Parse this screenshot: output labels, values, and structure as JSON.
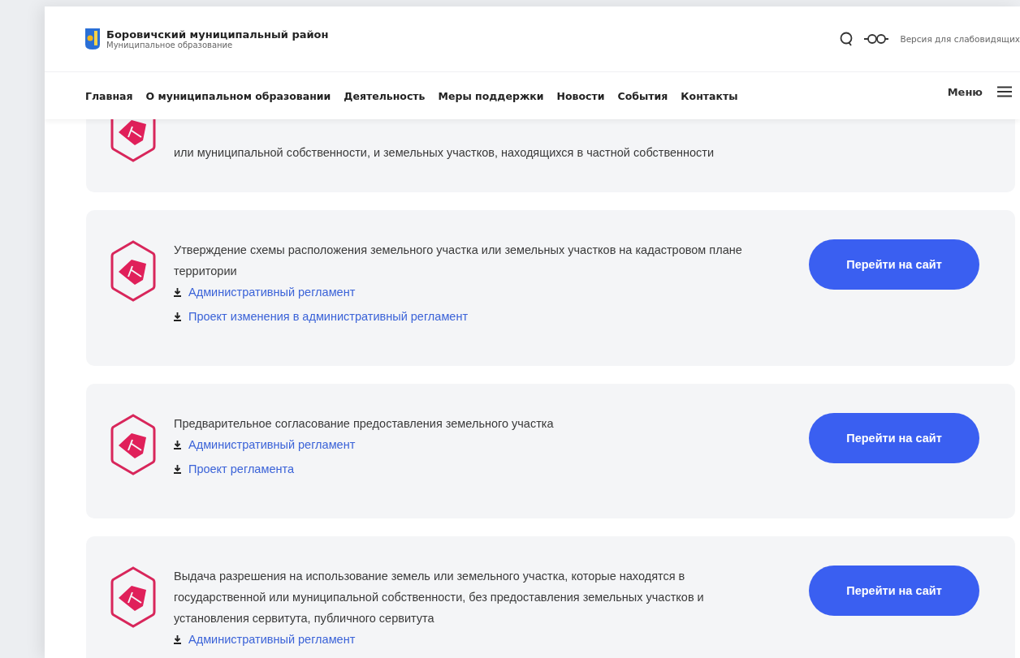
{
  "header": {
    "title": "Боровичский муниципальный район",
    "subtitle": "Муниципальное образование",
    "accessibility_link": "Версия для слабовидящих"
  },
  "nav": {
    "items": [
      "Главная",
      "О муниципальном образовании",
      "Деятельность",
      "Меры поддержки",
      "Новости",
      "События",
      "Контакты"
    ],
    "menu_label": "Меню"
  },
  "services": [
    {
      "text": "или муниципальной собственности, и земельных участков, находящихся в частной собственности"
    },
    {
      "text": "Утверждение схемы расположения земельного участка или земельных участков на кадастровом плане территории",
      "links": [
        "Административный регламент",
        "Проект изменения в административный регламент"
      ],
      "button": "Перейти на сайт"
    },
    {
      "text": "Предварительное согласование предоставления земельного участка",
      "links": [
        "Административный регламент",
        "Проект регламента"
      ],
      "button": "Перейти на сайт"
    },
    {
      "text": "Выдача разрешения на использование земель или земельного участка, которые находятся в государственной или муниципальной собственности, без предоставления земельных участков и установления сервитута, публичного сервитута",
      "links": [
        "Административный регламент"
      ],
      "button": "Перейти на сайт"
    }
  ]
}
